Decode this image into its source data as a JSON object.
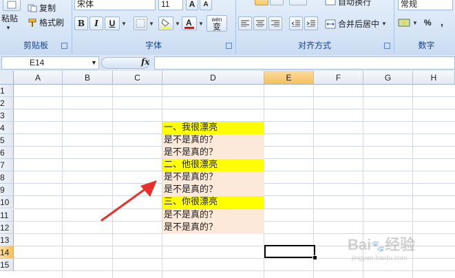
{
  "ribbon": {
    "clipboard": {
      "label": "剪贴板",
      "paste": "粘贴",
      "copy": "复制",
      "format_painter": "格式刷"
    },
    "font": {
      "label": "字体",
      "font_name": "宋体",
      "font_size": "11",
      "bold": "B",
      "italic": "I",
      "underline": "U",
      "grow": "A",
      "shrink": "A",
      "wen": "wén",
      "wen_char": "变"
    },
    "alignment": {
      "label": "对齐方式",
      "wrap": "自动换行",
      "merge": "合并后居中"
    },
    "number": {
      "label": "数字",
      "format": "常规",
      "percent": "%",
      "comma": ","
    }
  },
  "formula_bar": {
    "name_box": "E14",
    "fx": "fx",
    "formula": ""
  },
  "columns": [
    "A",
    "B",
    "C",
    "D",
    "E",
    "F",
    "G",
    "H"
  ],
  "rows": [
    "1",
    "2",
    "3",
    "4",
    "5",
    "6",
    "7",
    "8",
    "9",
    "10",
    "11",
    "12",
    "13",
    "14",
    "15"
  ],
  "selected_cell": {
    "col": "E",
    "row": "14"
  },
  "cells": [
    {
      "row": "4",
      "text": "一、我很漂亮",
      "style": "heading"
    },
    {
      "row": "5",
      "text": "是不是真的？",
      "style": "body"
    },
    {
      "row": "6",
      "text": "是不是真的？",
      "style": "body"
    },
    {
      "row": "7",
      "text": "二、他很漂亮",
      "style": "heading"
    },
    {
      "row": "8",
      "text": "是不是真的？",
      "style": "body"
    },
    {
      "row": "9",
      "text": "是不是真的？",
      "style": "body"
    },
    {
      "row": "10",
      "text": "三、你很漂亮",
      "style": "heading"
    },
    {
      "row": "11",
      "text": "是不是真的？",
      "style": "body"
    },
    {
      "row": "12",
      "text": "是不是真的？",
      "style": "body"
    }
  ],
  "colors": {
    "heading_fill": "#ffff00",
    "body_fill": "#fde9d9",
    "arrow": "#e8302a",
    "gridline": "#d0d7e5"
  },
  "watermark": {
    "brand": "Bai",
    "brand2": "经验",
    "url": "jingyan.baidu.com"
  }
}
